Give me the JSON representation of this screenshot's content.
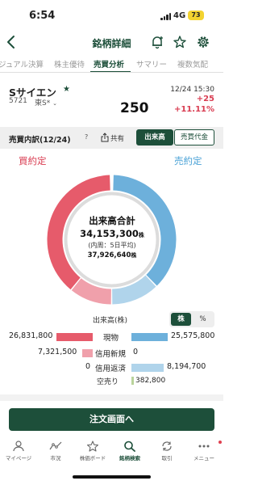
{
  "status": {
    "time": "6:54",
    "network": "4G",
    "battery": "73"
  },
  "header": {
    "title": "銘柄詳細"
  },
  "tabs": [
    {
      "label": "ジュアル決算",
      "active": false
    },
    {
      "label": "株主優待",
      "active": false
    },
    {
      "label": "売買分析",
      "active": true
    },
    {
      "label": "サマリー",
      "active": false
    },
    {
      "label": "複数気配",
      "active": false
    }
  ],
  "stock": {
    "name": "Sサイエン",
    "code": "5721",
    "market": "東S*",
    "datetime": "12/24 15:30",
    "price": "250",
    "change": "+25",
    "change_pct": "+11.11%"
  },
  "breakdown": {
    "title": "売買内訳(12/24)",
    "help": "?",
    "share_label": "共有",
    "volume_label": "出来高",
    "value_label": "売買代金"
  },
  "chart": {
    "buy_label": "買約定",
    "sell_label": "売約定",
    "center_title": "出来高合計",
    "total": "34,153,300",
    "total_unit": "株",
    "avg_label": "(内周：5日平均)",
    "avg_value": "37,926,640",
    "avg_unit": "株"
  },
  "table": {
    "header": "出来高(株)",
    "unit_stock": "株",
    "unit_pct": "%",
    "rows": [
      {
        "label": "現物",
        "buy": "26,831,800",
        "sell": "25,575,800"
      },
      {
        "label": "信用新規",
        "buy": "7,321,500",
        "sell": "0"
      },
      {
        "label": "信用返済",
        "buy": "0",
        "sell": "8,194,700"
      }
    ],
    "short_label": "空売り",
    "short_value": "382,800"
  },
  "chart_data": {
    "type": "pie",
    "title": "出来高合計",
    "total": 34153300,
    "outer_ring": [
      {
        "name": "買 現物",
        "value": 26831800,
        "color": "#e65b6b"
      },
      {
        "name": "買 信用新規",
        "value": 7321500,
        "color": "#f0a0ab"
      },
      {
        "name": "売 現物",
        "value": 25575800,
        "color": "#6db0db"
      },
      {
        "name": "売 信用返済",
        "value": 8194700,
        "color": "#b0d4eb"
      }
    ],
    "inner_ring_5day_avg": 37926640,
    "legend": [
      "買約定",
      "売約定"
    ]
  },
  "order_button": {
    "label": "注文画面へ"
  },
  "bottom_nav": [
    {
      "label": "マイページ",
      "icon": "person-icon",
      "active": false
    },
    {
      "label": "市況",
      "icon": "market-icon",
      "active": false
    },
    {
      "label": "株価ボード",
      "icon": "star-icon",
      "active": false
    },
    {
      "label": "銘柄検索",
      "icon": "search-icon",
      "active": true
    },
    {
      "label": "取引",
      "icon": "trade-icon",
      "active": false
    },
    {
      "label": "メニュー",
      "icon": "menu-icon",
      "active": false
    }
  ],
  "colors": {
    "brand": "#1d4f3a",
    "buy": "#e65b6b",
    "buy_light": "#f0a0ab",
    "sell": "#6db0db",
    "sell_light": "#b0d4eb",
    "up": "#d93d52"
  }
}
